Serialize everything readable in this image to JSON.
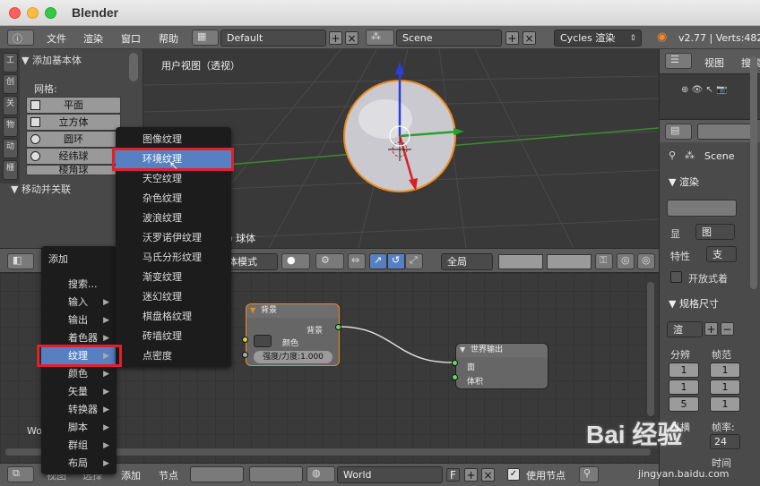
{
  "window": {
    "title": "Blender"
  },
  "info_header": {
    "menus": [
      "文件",
      "渲染",
      "窗口",
      "帮助"
    ],
    "layout": "Default",
    "scene": "Scene",
    "engine": "Cycles 渲染",
    "version": "v2.77 | Verts:482"
  },
  "viewport": {
    "label": "用户视图（透视）",
    "object_label": "(194) 球体"
  },
  "toolshelf": {
    "panel_title": "▼ 添加基本体",
    "mesh_label": "网格:",
    "mesh_items": [
      "平面",
      "立方体",
      "圆环",
      "经纬球",
      "棱角球"
    ],
    "panel2_title": "▼ 移动并关联",
    "vertical_tabs": [
      "工",
      "创",
      "关",
      "物",
      "动",
      "栅"
    ]
  },
  "node_header": {
    "mode": "物体模式",
    "global": "全局"
  },
  "add_menu": {
    "title": "添加",
    "items": [
      {
        "label": "搜索...",
        "submenu": false
      },
      {
        "label": "输入",
        "submenu": true
      },
      {
        "label": "输出",
        "submenu": true
      },
      {
        "label": "着色器",
        "submenu": true
      },
      {
        "label": "纹理",
        "submenu": true,
        "highlighted": true
      },
      {
        "label": "颜色",
        "submenu": true
      },
      {
        "label": "矢量",
        "submenu": true
      },
      {
        "label": "转换器",
        "submenu": true
      },
      {
        "label": "脚本",
        "submenu": true
      },
      {
        "label": "群组",
        "submenu": true
      },
      {
        "label": "布局",
        "submenu": true
      }
    ]
  },
  "texture_menu": {
    "items": [
      "图像纹理",
      "环境纹理",
      "天空纹理",
      "杂色纹理",
      "波浪纹理",
      "沃罗诺伊纹理",
      "马氏分形纹理",
      "渐变纹理",
      "迷幻纹理",
      "棋盘格纹理",
      "砖墙纹理",
      "点密度"
    ],
    "highlighted_index": 1
  },
  "nodes": {
    "background": {
      "title": "背景",
      "output": "背景",
      "color_label": "颜色",
      "strength": "强度/力度:1.000"
    },
    "world_output": {
      "title": "世界输出",
      "input_surface": "面",
      "input_volume": "体积"
    }
  },
  "node_area": {
    "world_label": "World"
  },
  "bottom_bar": {
    "view": "视图",
    "select": "选择",
    "add": "添加",
    "node": "节点",
    "world_name": "World",
    "f_label": "F",
    "use_nodes": "使用节点"
  },
  "properties": {
    "view": "视图",
    "search": "搜索",
    "scene": "Scene",
    "render_panel": "▼ 渲染",
    "display_label": "显",
    "display_value": "图",
    "feature_label": "特性",
    "feature_value": "支",
    "open_shading": "开放式着",
    "dimensions_panel": "▼ 规格尺寸",
    "preset": "渲",
    "resolution": "分辨",
    "frame_range": "帧范",
    "fields": [
      "1",
      "1",
      "5",
      "1",
      "1",
      "1"
    ],
    "aspect": "纵横",
    "frame_rate": "帧率:",
    "fps_value": "24",
    "time": "时间"
  },
  "watermark": {
    "brand": "Bai 经验",
    "url": "jingyan.baidu.com"
  }
}
